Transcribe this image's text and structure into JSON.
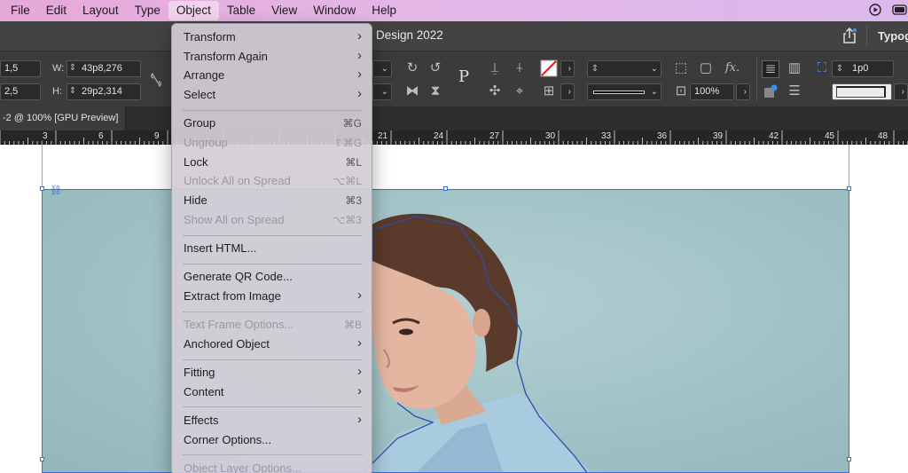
{
  "menubar": {
    "items": [
      "File",
      "Edit",
      "Layout",
      "Type",
      "Object",
      "Table",
      "View",
      "Window",
      "Help"
    ],
    "active": "Object"
  },
  "titlebar": {
    "title": "Design 2022",
    "workspace": "Typog"
  },
  "controls": {
    "x_value": "1,5",
    "y_value": "2,5",
    "w_label": "W:",
    "w_value": "43p8,276",
    "h_label": "H:",
    "h_value": "29p2,314",
    "zoom_value": "100%",
    "stroke_weight": "1p0"
  },
  "tab": {
    "label": "-2 @ 100% [GPU Preview]"
  },
  "ruler": {
    "labels": [
      "3",
      "6",
      "9",
      "21",
      "24",
      "27",
      "30",
      "33",
      "36",
      "39",
      "42",
      "45",
      "48"
    ]
  },
  "menu": {
    "groups": [
      [
        {
          "label": "Transform",
          "submenu": true,
          "enabled": true
        },
        {
          "label": "Transform Again",
          "submenu": true,
          "enabled": true
        },
        {
          "label": "Arrange",
          "submenu": true,
          "enabled": true
        },
        {
          "label": "Select",
          "submenu": true,
          "enabled": true
        }
      ],
      [
        {
          "label": "Group",
          "shortcut": "⌘G",
          "enabled": true
        },
        {
          "label": "Ungroup",
          "shortcut": "⇧⌘G",
          "enabled": false
        },
        {
          "label": "Lock",
          "shortcut": "⌘L",
          "enabled": true
        },
        {
          "label": "Unlock All on Spread",
          "shortcut": "⌥⌘L",
          "enabled": false
        },
        {
          "label": "Hide",
          "shortcut": "⌘3",
          "enabled": true
        },
        {
          "label": "Show All on Spread",
          "shortcut": "⌥⌘3",
          "enabled": false
        }
      ],
      [
        {
          "label": "Insert HTML...",
          "enabled": true
        }
      ],
      [
        {
          "label": "Generate QR Code...",
          "enabled": true
        },
        {
          "label": "Extract from Image",
          "submenu": true,
          "enabled": true
        }
      ],
      [
        {
          "label": "Text Frame Options...",
          "shortcut": "⌘B",
          "enabled": false
        },
        {
          "label": "Anchored Object",
          "submenu": true,
          "enabled": true
        }
      ],
      [
        {
          "label": "Fitting",
          "submenu": true,
          "enabled": true
        },
        {
          "label": "Content",
          "submenu": true,
          "enabled": true
        }
      ],
      [
        {
          "label": "Effects",
          "submenu": true,
          "enabled": true
        },
        {
          "label": "Corner Options...",
          "enabled": true
        }
      ],
      [
        {
          "label": "Object Layer Options...",
          "enabled": false
        }
      ]
    ]
  },
  "colors": {
    "menubar_accent": "#e3b6e6",
    "selection_blue": "#3c6fd4",
    "photo_bg": "#a3c4c8",
    "margin_guide": "#d67ed8"
  }
}
